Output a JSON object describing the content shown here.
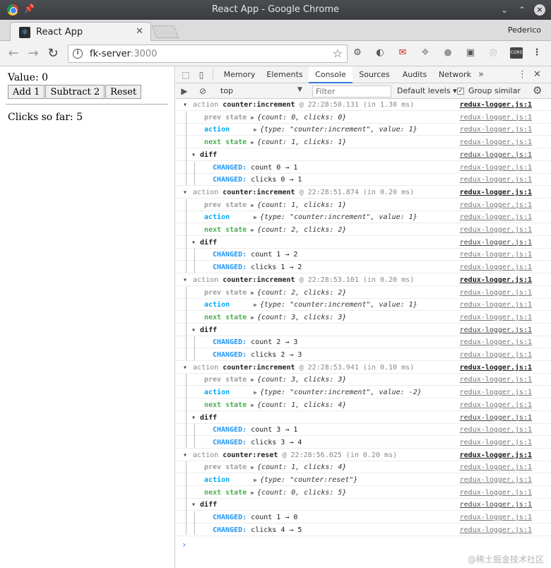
{
  "window": {
    "title": "React App - Google Chrome",
    "profile": "Pederico",
    "tab_title": "React App"
  },
  "address": {
    "host": "fk-server",
    "port": ":3000"
  },
  "app": {
    "value_text": "Value: 0",
    "buttons": [
      "Add 1",
      "Subtract 2",
      "Reset"
    ],
    "clicks_text": "Clicks so far: 5"
  },
  "devtools": {
    "tabs": [
      "Memory",
      "Elements",
      "Console",
      "Sources",
      "Audits",
      "Network"
    ],
    "active_tab": "Console",
    "context": "top",
    "filter_placeholder": "Filter",
    "levels": "Default levels",
    "group_similar": "Group similar",
    "group_similar_checked": true
  },
  "log_labels": {
    "action_word": "action",
    "prev_state": "prev state",
    "action": "action",
    "next_state": "next state",
    "diff": "diff",
    "changed": "CHANGED:"
  },
  "logs": [
    {
      "type": "counter:increment",
      "meta": "@ 22:28:50.131 (in 1.30 ms)",
      "prev": "{count: 0, clicks: 0}",
      "action": "{type: \"counter:increment\", value: 1}",
      "next": "{count: 1, clicks: 1}",
      "diff": [
        "count 0 → 1",
        "clicks 0 → 1"
      ]
    },
    {
      "type": "counter:increment",
      "meta": "@ 22:28:51.874 (in 0.20 ms)",
      "prev": "{count: 1, clicks: 1}",
      "action": "{type: \"counter:increment\", value: 1}",
      "next": "{count: 2, clicks: 2}",
      "diff": [
        "count 1 → 2",
        "clicks 1 → 2"
      ]
    },
    {
      "type": "counter:increment",
      "meta": "@ 22:28:53.101 (in 0.20 ms)",
      "prev": "{count: 2, clicks: 2}",
      "action": "{type: \"counter:increment\", value: 1}",
      "next": "{count: 3, clicks: 3}",
      "diff": [
        "count 2 → 3",
        "clicks 2 → 3"
      ]
    },
    {
      "type": "counter:increment",
      "meta": "@ 22:28:53.941 (in 0.10 ms)",
      "prev": "{count: 3, clicks: 3}",
      "action": "{type: \"counter:increment\", value: -2}",
      "next": "{count: 1, clicks: 4}",
      "diff": [
        "count 3 → 1",
        "clicks 3 → 4"
      ]
    },
    {
      "type": "counter:reset",
      "meta": "@ 22:28:56.025 (in 0.20 ms)",
      "prev": "{count: 1, clicks: 4}",
      "action": "{type: \"counter:reset\"}",
      "next": "{count: 0, clicks: 5}",
      "diff": [
        "count 1 → 0",
        "clicks 4 → 5"
      ]
    }
  ],
  "source_link": "redux-logger.js:1",
  "prompt": "›",
  "watermark": "@稀土掘金技术社区"
}
